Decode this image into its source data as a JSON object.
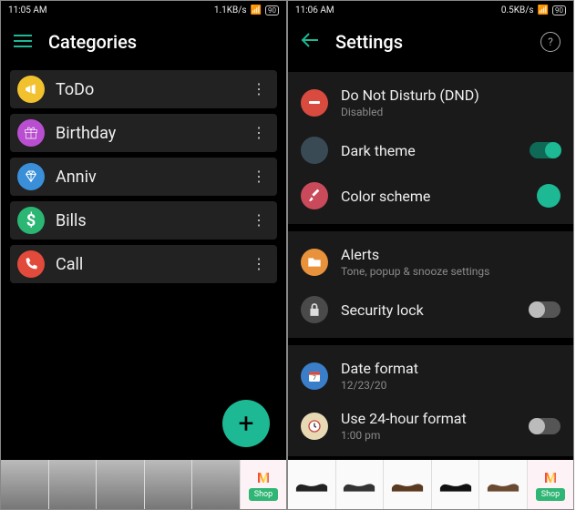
{
  "left": {
    "status": {
      "time": "11:05 AM",
      "net": "1.1KB/s",
      "battery": "90"
    },
    "appbar": {
      "title": "Categories"
    },
    "categories": [
      {
        "label": "ToDo",
        "color": "#f2c12e",
        "icon": "megaphone"
      },
      {
        "label": "Birthday",
        "color": "#b94fd0",
        "icon": "gift"
      },
      {
        "label": "Anniv",
        "color": "#3a8fd9",
        "icon": "diamond"
      },
      {
        "label": "Bills",
        "color": "#2bb673",
        "icon": "dollar"
      },
      {
        "label": "Call",
        "color": "#e24a3b",
        "icon": "phone"
      }
    ],
    "fab": "+",
    "ad": {
      "shop": "Shop"
    }
  },
  "right": {
    "status": {
      "time": "11:06 AM",
      "net": "0.5KB/s",
      "battery": "90"
    },
    "appbar": {
      "title": "Settings"
    },
    "rows": {
      "dnd": {
        "title": "Do Not Disturb (DND)",
        "sub": "Disabled"
      },
      "dark": {
        "title": "Dark theme"
      },
      "color": {
        "title": "Color scheme"
      },
      "alerts": {
        "title": "Alerts",
        "sub": "Tone, popup & snooze settings"
      },
      "lock": {
        "title": "Security lock"
      },
      "date": {
        "title": "Date format",
        "sub": "12/23/20"
      },
      "h24": {
        "title": "Use 24-hour format",
        "sub": "1:00 pm"
      }
    },
    "ad": {
      "shop": "Shop"
    }
  }
}
